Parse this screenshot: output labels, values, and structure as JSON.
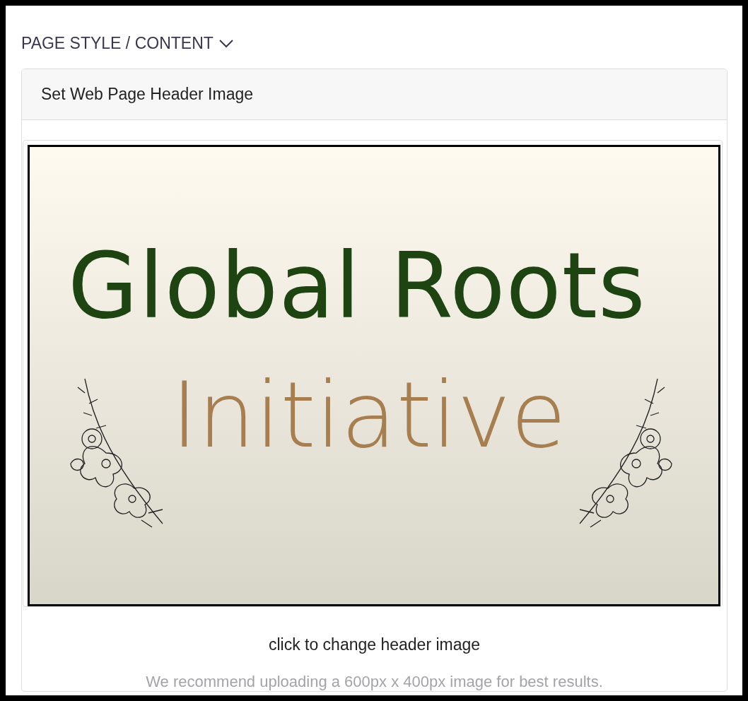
{
  "section": {
    "title": "PAGE STYLE / CONTENT",
    "expanded": true
  },
  "card": {
    "header": "Set Web Page Header Image",
    "image": {
      "line_1": "Global Roots",
      "line_2": "Initiative"
    },
    "caption": "click to change header image",
    "hint": "We recommend uploading a 600px x 400px image for best results."
  }
}
